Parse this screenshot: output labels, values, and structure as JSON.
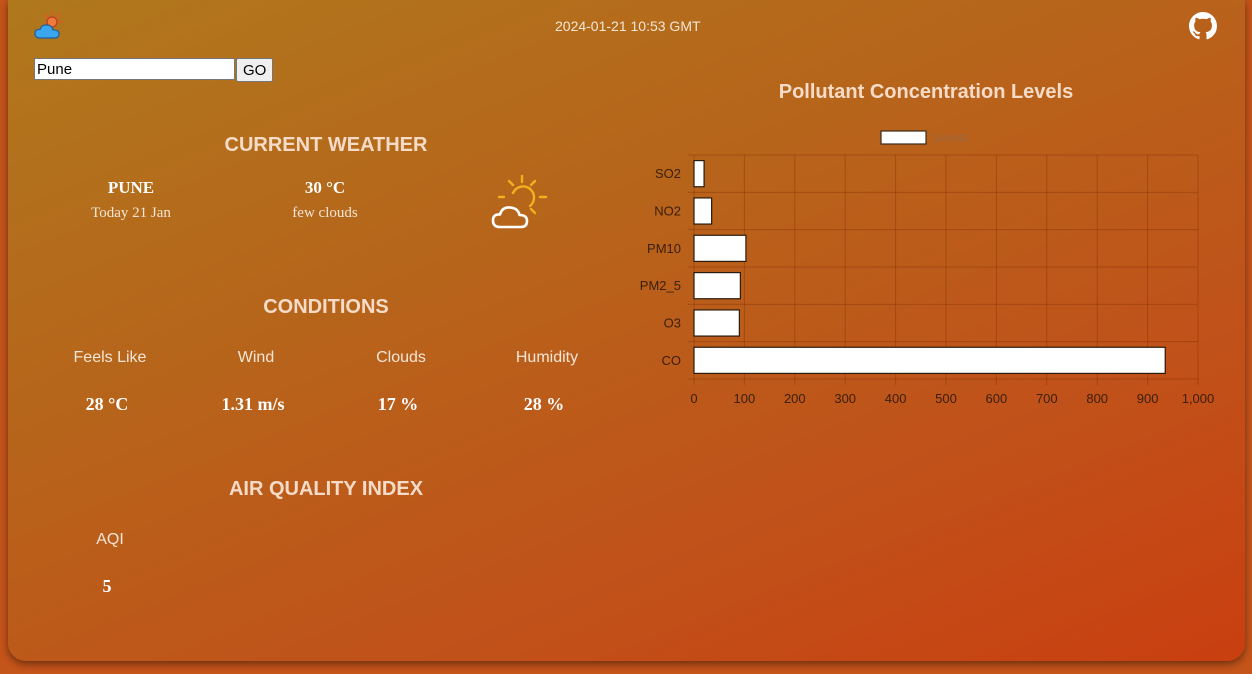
{
  "header": {
    "datetime": "2024-01-21 10:53 GMT",
    "logo_icon": "weather-logo-icon",
    "github_icon": "github-icon"
  },
  "search": {
    "value": "Pune",
    "button_label": "GO"
  },
  "current_weather": {
    "title": "CURRENT WEATHER",
    "city": "PUNE",
    "date": "Today 21 Jan",
    "temperature": "30 °C",
    "description": "few clouds",
    "icon": "partly-cloudy-icon"
  },
  "conditions": {
    "title": "CONDITIONS",
    "items": [
      {
        "label": "Feels Like",
        "value": "28 °C"
      },
      {
        "label": "Wind",
        "value": "1.31 m/s"
      },
      {
        "label": "Clouds",
        "value": "17 %"
      },
      {
        "label": "Humidity",
        "value": "28 %"
      }
    ]
  },
  "aqi": {
    "title": "AIR QUALITY INDEX",
    "label": "AQI",
    "value": "5"
  },
  "chart_data": {
    "type": "bar",
    "orientation": "horizontal",
    "title": "Pollutant Concentration Levels",
    "legend": "top",
    "categories": [
      "SO2",
      "NO2",
      "PM10",
      "PM2_5",
      "O3",
      "CO"
    ],
    "series": [
      {
        "name": "Levels",
        "values": [
          20,
          35,
          103,
          92,
          90,
          935
        ]
      }
    ],
    "xlim": [
      0,
      1000
    ],
    "x_ticks": [
      "0",
      "100",
      "200",
      "300",
      "400",
      "500",
      "600",
      "700",
      "800",
      "900",
      "1,000"
    ],
    "grid": true,
    "bar_color": "#ffffff"
  }
}
